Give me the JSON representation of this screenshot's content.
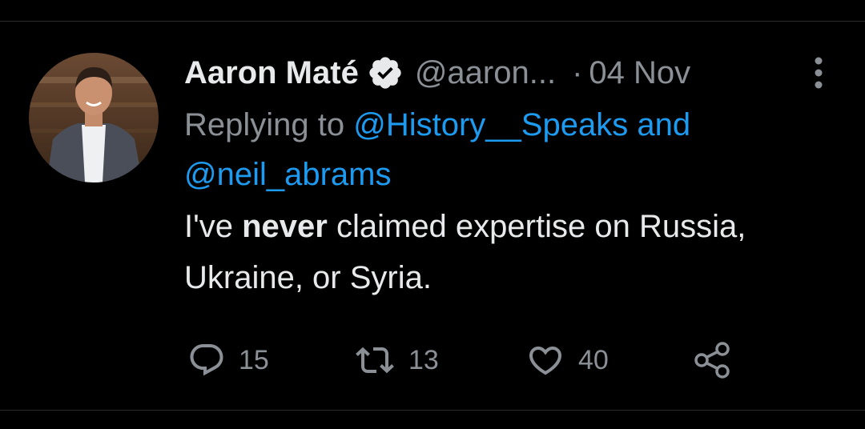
{
  "tweet": {
    "author": {
      "display_name": "Aaron Maté",
      "handle": "@aaron...",
      "verified": true,
      "avatar_icon": "profile-photo"
    },
    "separator": "·",
    "timestamp": "04 Nov",
    "reply": {
      "prefix": "Replying to",
      "mention_1": "@History__Speaks",
      "conjunction": "and",
      "mention_2": "@neil_abrams"
    },
    "text": {
      "part1": "I've ",
      "bold": "never",
      "part2": " claimed expertise on Russia, Ukraine, or Syria."
    },
    "actions": {
      "reply": {
        "icon": "comment-icon",
        "count": "15"
      },
      "retweet": {
        "icon": "retweet-icon",
        "count": "13"
      },
      "like": {
        "icon": "heart-icon",
        "count": "40"
      },
      "share": {
        "icon": "share-icon"
      }
    },
    "colors": {
      "background": "#000000",
      "text": "#e7e9ea",
      "muted": "#8b9096",
      "link": "#1d9bf0"
    }
  }
}
